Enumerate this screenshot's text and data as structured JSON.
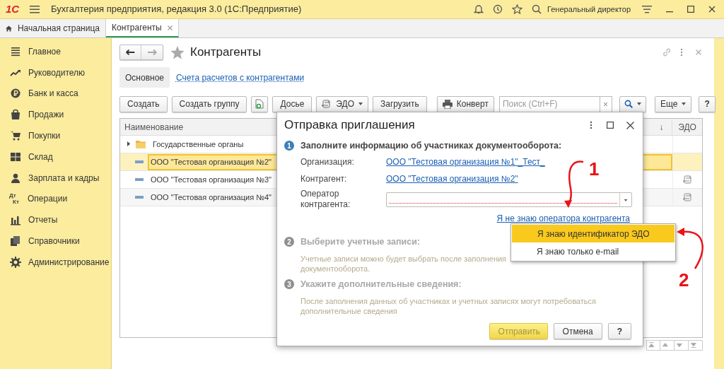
{
  "app_header": {
    "logo": "1С",
    "title": "Бухгалтерия предприятия, редакция 3.0  (1С:Предприятие)",
    "user": "Генеральный директор"
  },
  "open_tabs": [
    {
      "label": "Начальная страница",
      "selected": false,
      "kind": "home"
    },
    {
      "label": "Контрагенты",
      "selected": true,
      "kind": "page"
    }
  ],
  "sidebar": {
    "items": [
      {
        "label": "Главное"
      },
      {
        "label": "Руководителю"
      },
      {
        "label": "Банк и касса"
      },
      {
        "label": "Продажи"
      },
      {
        "label": "Покупки"
      },
      {
        "label": "Склад"
      },
      {
        "label": "Зарплата и кадры"
      },
      {
        "label": "Операции",
        "icon_text": [
          "Дт",
          "Кт"
        ]
      },
      {
        "label": "Отчеты"
      },
      {
        "label": "Справочники"
      },
      {
        "label": "Администрирование"
      }
    ]
  },
  "form": {
    "title": "Контрагенты",
    "sections": [
      {
        "label": "Основное",
        "selected": true
      },
      {
        "label": "Счета расчетов с контрагентами",
        "selected": false
      }
    ],
    "toolbar": [
      {
        "kind": "text",
        "label": "Создать"
      },
      {
        "kind": "text",
        "label": "Создать группу"
      },
      {
        "kind": "add-icon"
      },
      {
        "kind": "text",
        "label": "Досье"
      },
      {
        "kind": "edo",
        "label": "ЭДО"
      },
      {
        "kind": "text",
        "label": "Загрузить"
      },
      {
        "kind": "print",
        "label": "Конверт"
      },
      {
        "kind": "search"
      },
      {
        "kind": "search-button"
      },
      {
        "kind": "menu",
        "label": "Еще"
      },
      {
        "kind": "help",
        "label": "?"
      }
    ],
    "search": {
      "placeholder": "Поиск (Ctrl+F)"
    },
    "table": {
      "columns": [
        "Наименование",
        "↓",
        "ЭДО"
      ],
      "rows": [
        {
          "kind": "group",
          "name": "Государственные органы",
          "expanded": false,
          "selected": false,
          "edo": false
        },
        {
          "kind": "item",
          "name": "ООО \"Тестовая организация №2\"",
          "selected": true,
          "edo": false
        },
        {
          "kind": "item",
          "name": "ООО \"Тестовая организация №3\"",
          "selected": false,
          "edo": true
        },
        {
          "kind": "item",
          "name": "ООО \"Тестовая организация №4\"",
          "selected": false,
          "edo": true
        }
      ]
    }
  },
  "dialog": {
    "title": "Отправка приглашения",
    "steps": [
      {
        "number": "1",
        "active": true,
        "title": "Заполните информацию об участниках документооборота:"
      },
      {
        "number": "2",
        "active": false,
        "title": "Выберите учетные записи:",
        "note": [
          "Учетные записи можно будет выбрать после заполнения",
          "документооборота."
        ]
      },
      {
        "number": "3",
        "active": false,
        "title": "Укажите дополнительные сведения:",
        "note": [
          "После заполнения данных об участниках и учетных записях могут потребоваться",
          "дополнительные сведения"
        ]
      }
    ],
    "fields": [
      {
        "kind": "link",
        "label": "Организация:",
        "value": "ООО \"Тестовая организация №1\"_Тест_"
      },
      {
        "kind": "link",
        "label": "Контрагент:",
        "value": "ООО \"Тестовая организация №2\""
      },
      {
        "kind": "select",
        "label": "Оператор контрагента:",
        "required": true
      }
    ],
    "link": "Я не знаю оператора контрагента",
    "buttons": [
      {
        "label": "Отправить",
        "kind": "default"
      },
      {
        "label": "Отмена",
        "kind": "normal"
      },
      {
        "label": "?",
        "kind": "help"
      }
    ]
  },
  "popup_menu": {
    "items": [
      {
        "label": "Я знаю идентификатор ЭДО",
        "selected": true
      },
      {
        "label": "Я знаю только e-mail",
        "selected": false
      }
    ]
  },
  "annotations": [
    {
      "label": "1"
    },
    {
      "label": "2"
    }
  ]
}
